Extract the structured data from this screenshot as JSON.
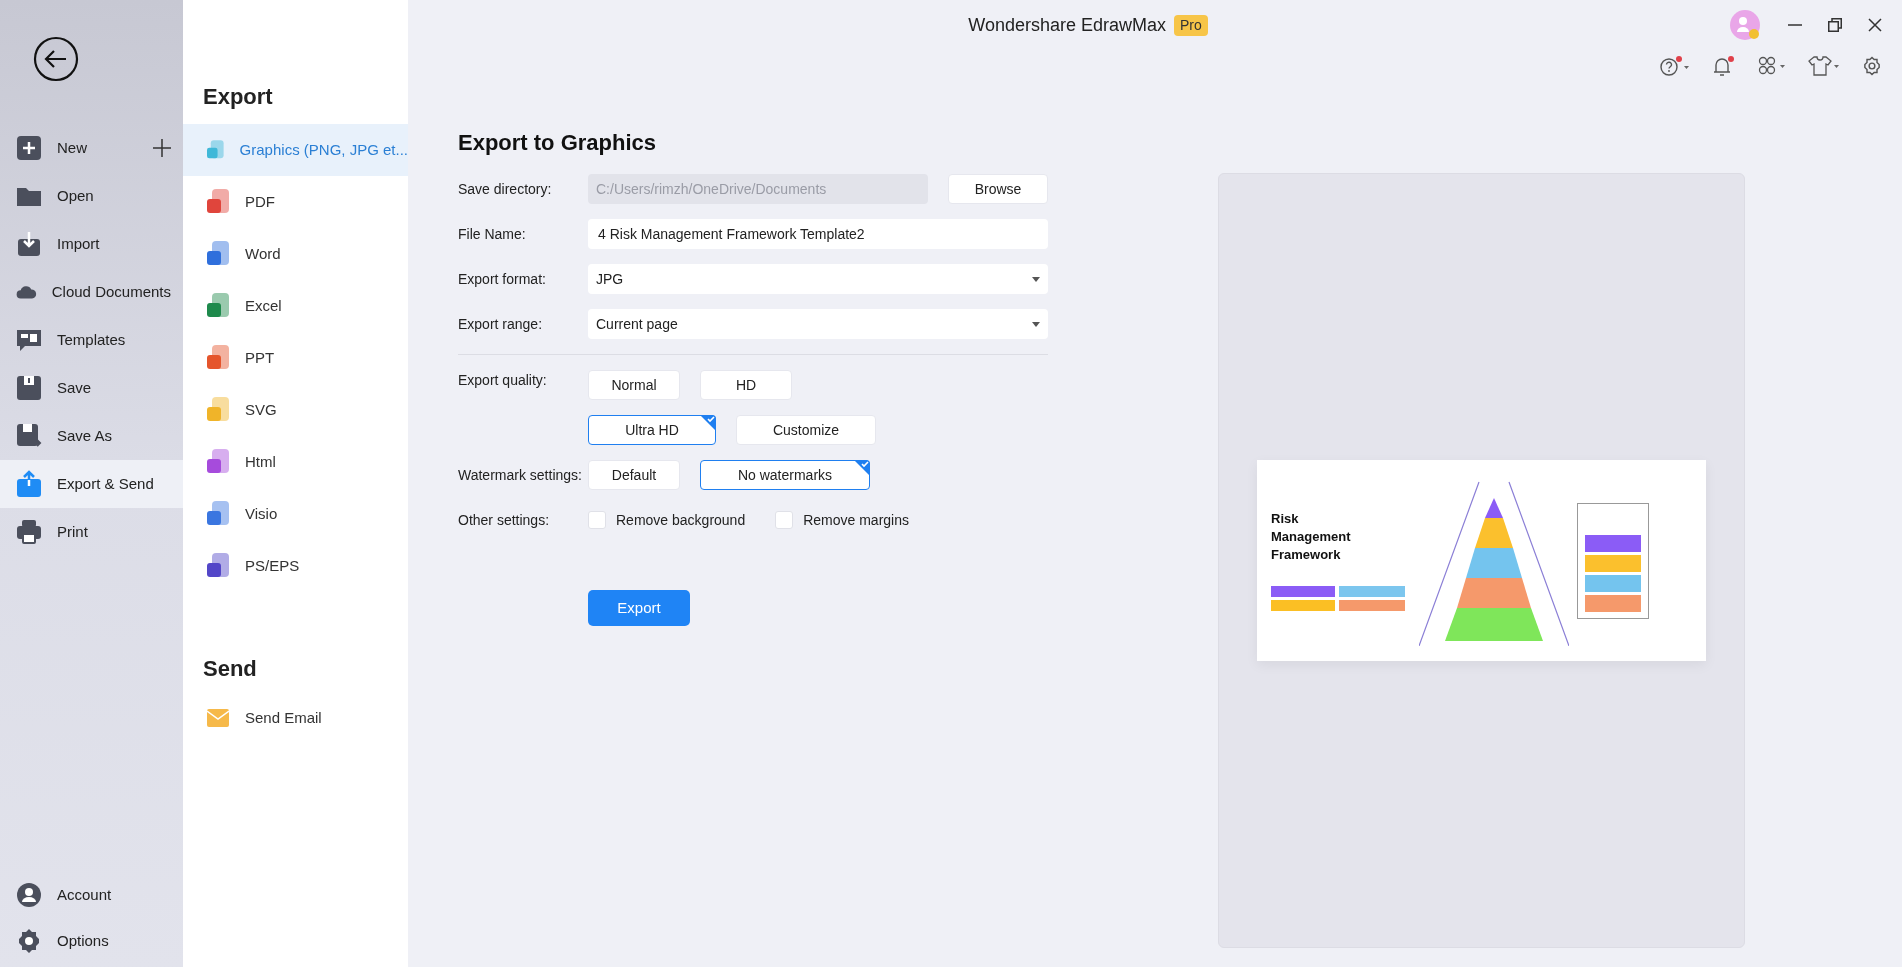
{
  "window": {
    "title": "Wondershare EdrawMax",
    "badge": "Pro"
  },
  "sidebar": {
    "items": [
      {
        "kind": "new",
        "label": "New",
        "selected": false
      },
      {
        "kind": "open",
        "label": "Open",
        "selected": false
      },
      {
        "kind": "import",
        "label": "Import",
        "selected": false
      },
      {
        "kind": "cloud",
        "label": "Cloud Documents",
        "selected": false
      },
      {
        "kind": "templates",
        "label": "Templates",
        "selected": false
      },
      {
        "kind": "save",
        "label": "Save",
        "selected": false
      },
      {
        "kind": "saveas",
        "label": "Save As",
        "selected": false
      },
      {
        "kind": "export",
        "label": "Export & Send",
        "selected": true
      },
      {
        "kind": "print",
        "label": "Print",
        "selected": false
      }
    ],
    "bottom": [
      {
        "kind": "account",
        "label": "Account"
      },
      {
        "kind": "options",
        "label": "Options"
      }
    ]
  },
  "export_panel": {
    "heading": "Export",
    "items": [
      {
        "label": "Graphics (PNG, JPG et...",
        "color": "#3fb8d8",
        "selected": true
      },
      {
        "label": "PDF",
        "color": "#e0453c",
        "selected": false
      },
      {
        "label": "Word",
        "color": "#2f6fdc",
        "selected": false
      },
      {
        "label": "Excel",
        "color": "#1e8a4c",
        "selected": false
      },
      {
        "label": "PPT",
        "color": "#e5552c",
        "selected": false
      },
      {
        "label": "SVG",
        "color": "#f0b429",
        "selected": false
      },
      {
        "label": "Html",
        "color": "#a64bdc",
        "selected": false
      },
      {
        "label": "Visio",
        "color": "#3a76e0",
        "selected": false
      },
      {
        "label": "PS/EPS",
        "color": "#5346c8",
        "selected": false
      }
    ],
    "send_heading": "Send",
    "send_items": [
      {
        "label": "Send Email"
      }
    ]
  },
  "form": {
    "title": "Export to Graphics",
    "save_directory": {
      "label": "Save directory:",
      "value": "C:/Users/rimzh/OneDrive/Documents",
      "disabled": true,
      "button": "Browse"
    },
    "file_name": {
      "label": "File Name:",
      "value": "4 Risk Management Framework Template2"
    },
    "export_format": {
      "label": "Export format:",
      "value": "JPG"
    },
    "export_range": {
      "label": "Export range:",
      "value": "Current page"
    },
    "export_quality": {
      "label": "Export quality:",
      "options": [
        {
          "label": "Normal",
          "selected": false
        },
        {
          "label": "HD",
          "selected": false
        },
        {
          "label": "Ultra HD",
          "selected": true
        },
        {
          "label": "Customize",
          "selected": false
        }
      ]
    },
    "watermark": {
      "label": "Watermark settings:",
      "options": [
        {
          "label": "Default",
          "selected": false
        },
        {
          "label": "No watermarks",
          "selected": true
        }
      ]
    },
    "other": {
      "label": "Other settings:",
      "checkboxes": [
        {
          "label": "Remove background",
          "checked": false
        },
        {
          "label": "Remove margins",
          "checked": false
        }
      ]
    },
    "export_button": "Export"
  },
  "preview": {
    "title": "Risk Management Framework"
  }
}
